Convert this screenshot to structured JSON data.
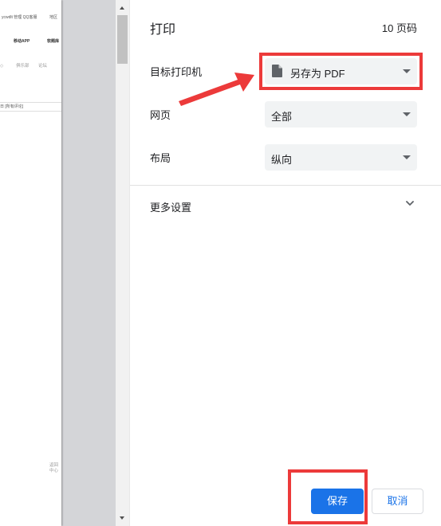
{
  "preview": {
    "header_links": "ycwdlt 管理 QQ客服",
    "header_right": "地区",
    "nav_app": "移动APP",
    "nav_soft": "软题库",
    "sub_left": "◇",
    "sub_club": "俱乐部",
    "sub_forum": "论坛",
    "crumb": "日 [所有评论]",
    "float_btn_1": "返回",
    "float_btn_2": "中心"
  },
  "settings": {
    "title": "打印",
    "page_count": "10 页码",
    "destination_label": "目标打印机",
    "destination_value": "另存为 PDF",
    "destination_icon": "file-icon",
    "pages_label": "网页",
    "pages_value": "全部",
    "layout_label": "布局",
    "layout_value": "纵向",
    "more_settings_label": "更多设置",
    "more_settings_icon": "chevron-down-icon"
  },
  "buttons": {
    "save": "保存",
    "cancel": "取消"
  },
  "colors": {
    "accent": "#1a73e8",
    "annotation": "#ec3a3a",
    "select_bg": "#f1f3f4"
  }
}
